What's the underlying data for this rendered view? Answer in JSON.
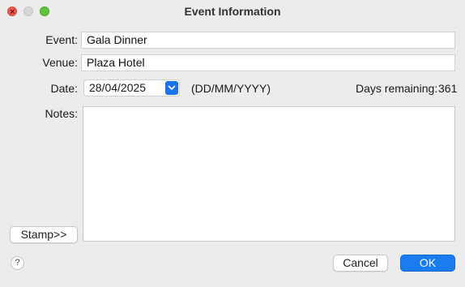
{
  "window": {
    "title": "Event Information"
  },
  "form": {
    "event_label": "Event:",
    "event_value": "Gala Dinner",
    "venue_label": "Venue:",
    "venue_value": "Plaza Hotel",
    "date_label": "Date:",
    "date_value": "28/04/2025",
    "date_format_hint": "(DD/MM/YYYY)",
    "days_remaining_label": "Days remaining:",
    "days_remaining_value": "361",
    "notes_label": "Notes:",
    "notes_value": ""
  },
  "buttons": {
    "stamp": "Stamp>>",
    "cancel": "Cancel",
    "ok": "OK",
    "help": "?"
  },
  "colors": {
    "accent": "#1b7bf0",
    "close": "#ee5a52",
    "maximize": "#5ec43a"
  },
  "icons": {
    "date_dropdown": "chevron-down-icon",
    "help": "help-icon"
  }
}
